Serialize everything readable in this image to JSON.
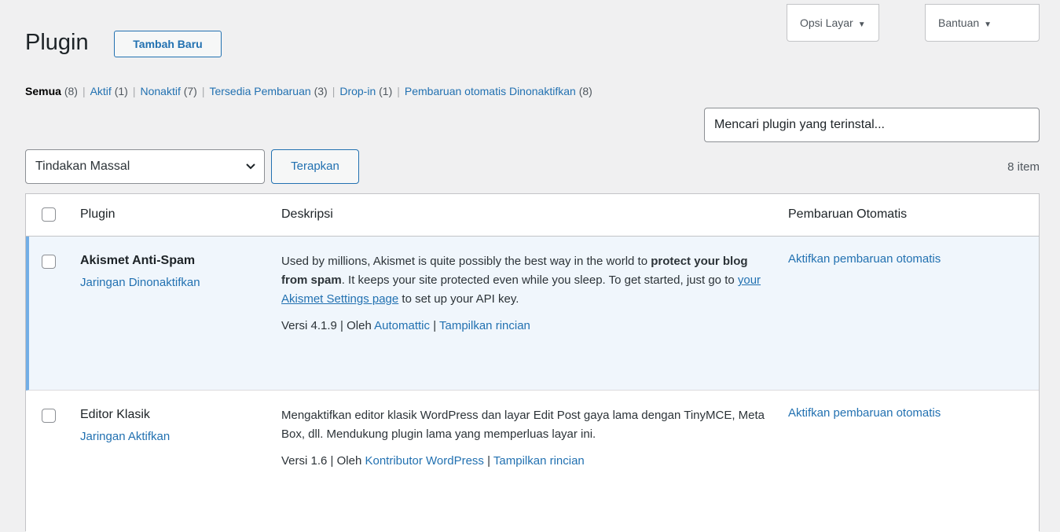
{
  "header": {
    "title": "Plugin",
    "add_new": "Tambah Baru",
    "screen_options": "Opsi Layar",
    "help": "Bantuan"
  },
  "filters": [
    {
      "label": "Semua",
      "count": "(8)"
    },
    {
      "label": "Aktif",
      "count": "(1)"
    },
    {
      "label": "Nonaktif",
      "count": "(7)"
    },
    {
      "label": "Tersedia Pembaruan",
      "count": "(3)"
    },
    {
      "label": "Drop-in",
      "count": "(1)"
    },
    {
      "label": "Pembaruan otomatis Dinonaktifkan",
      "count": "(8)"
    }
  ],
  "search": {
    "placeholder": "Mencari plugin yang terinstal..."
  },
  "bulk": {
    "selected": "Tindakan Massal",
    "apply": "Terapkan",
    "item_count": "8 item"
  },
  "table": {
    "headers": {
      "plugin": "Plugin",
      "description": "Deskripsi",
      "auto_update": "Pembaruan Otomatis"
    },
    "rows": [
      {
        "name": "Akismet Anti-Spam",
        "action": "Jaringan Dinonaktifkan",
        "desc_1": "Used by millions, Akismet is quite possibly the best way in the world to ",
        "desc_bold": "protect your blog from spam",
        "desc_2": ". It keeps your site protected even while you sleep. To get started, just go to ",
        "desc_link": "your Akismet Settings page",
        "desc_3": " to set up your API key.",
        "version": "Versi 4.1.9",
        "by": "Oleh",
        "author": "Automattic",
        "details": "Tampilkan rincian",
        "auto_update": "Aktifkan pembaruan otomatis"
      },
      {
        "name": "Editor Klasik",
        "action": "Jaringan Aktifkan",
        "desc_1": "Mengaktifkan editor klasik WordPress dan layar Edit Post gaya lama dengan TinyMCE, Meta Box, dll. Mendukung plugin lama yang memperluas layar ini.",
        "version": "Versi 1.6",
        "by": "Oleh",
        "author": "Kontributor WordPress",
        "details": "Tampilkan rincian",
        "auto_update": "Aktifkan pembaruan otomatis"
      }
    ]
  },
  "colors": {
    "link": "#2271b1",
    "inactive_row_bg": "#f0f6fc",
    "inactive_border": "#72aee6"
  }
}
